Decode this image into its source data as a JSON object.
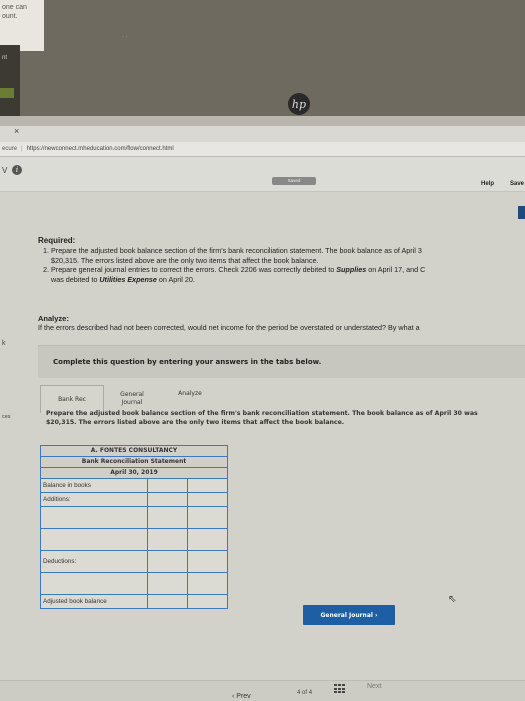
{
  "bezel": {
    "left_text_1": "one can",
    "left_text_2": "ount.",
    "left_text_3": "nt",
    "brand": "hp",
    "dots": "· ·"
  },
  "browser": {
    "tab_close": "×",
    "secure_label": "ecure",
    "url": "https://newconnect.mheducation.com/flow/connect.html"
  },
  "header": {
    "v_label": "V",
    "info_icon": "i",
    "saved_label": "Saved",
    "help_label": "Help",
    "save_label": "Save"
  },
  "required": {
    "title": "Required:",
    "item1_num": "1.",
    "item1_line1": "Prepare the adjusted book balance section of the firm's bank reconciliation statement. The book balance as of April 3",
    "item1_line2": "$20,315. The errors listed above are the only two items that affect the book balance.",
    "item2_num": "2.",
    "item2_line1_prefix": "Prepare general journal entries to correct the errors. Check 2206 was correctly debited to ",
    "item2_supplies": "Supplies",
    "item2_line1_suffix": " on April 17, and C",
    "item2_line2_prefix": "was debited to ",
    "item2_utilities": "Utilities Expense",
    "item2_line2_suffix": " on April 20."
  },
  "analyze": {
    "title": "Analyze:",
    "text": "If the errors described had not been corrected, would net income for the period be overstated or understated? By what a"
  },
  "side": {
    "k": "k",
    "ces": "ces"
  },
  "instructions": "Complete this question by entering your answers in the tabs below.",
  "tabs": [
    {
      "label": "Bank Rec"
    },
    {
      "label_line1": "General",
      "label_line2": "Journal"
    },
    {
      "label": "Analyze"
    }
  ],
  "prep_text_line1": "Prepare the adjusted book balance section of the firm's bank reconciliation statement. The book balance as of April 30 was",
  "prep_text_line2": "$20,315. The errors listed above are the only two items that affect the book balance.",
  "statement": {
    "company": "A. FONTES CONSULTANCY",
    "title": "Bank Reconciliation Statement",
    "date": "April 30, 2019",
    "rows": {
      "balance": "Balance in books",
      "additions": "Additions:",
      "deductions": "Deductions:",
      "adjusted": "Adjusted book balance"
    }
  },
  "buttons": {
    "general_journal": "General Journal  ›"
  },
  "footer": {
    "prev": "‹  Prev",
    "page_current": "4",
    "page_of": "of",
    "page_total": "4",
    "next": "Next"
  }
}
